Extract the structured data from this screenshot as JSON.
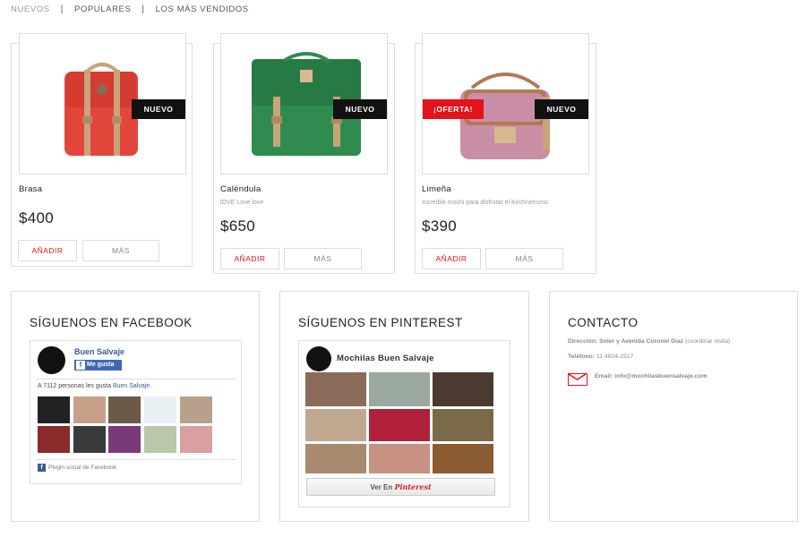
{
  "tabs": [
    {
      "label": "NUEVOS"
    },
    {
      "label": "POPULARES"
    },
    {
      "label": "LOS MÁS VENDIDOS"
    }
  ],
  "products": [
    {
      "name": "Brasa",
      "description": "",
      "price": "$400",
      "badges": [
        "NUEVO"
      ],
      "color": "#e2463b",
      "add_label": "AÑADIR",
      "more_label": "MÁS"
    },
    {
      "name": "Caléndula",
      "description": "lOVE Love love",
      "price": "$650",
      "badges": [
        "NUEVO"
      ],
      "color": "#2f8b4e",
      "add_label": "AÑADIR",
      "more_label": "MÁS"
    },
    {
      "name": "Limeña",
      "description": "Increíble mochi para disfrutar el Kirchnerismo.",
      "price": "$390",
      "badges": [
        "¡OFERTA!",
        "NUEVO"
      ],
      "color": "#c98ea5",
      "add_label": "AÑADIR",
      "more_label": "MÁS"
    }
  ],
  "facebook": {
    "heading": "SÍGUENOS EN FACEBOOK",
    "page_name": "Buen Salvaje",
    "like_label": "Me gusta",
    "count_text": "A 7112 personas les gusta",
    "count_link": "Buen Salvaje.",
    "plugin_label": "Plugin social de Facebook"
  },
  "pinterest": {
    "heading": "SÍGUENOS EN PINTEREST",
    "board_name": "Mochilas Buen Salvaje",
    "button_prefix": "Ver En",
    "button_brand": "Pinterest"
  },
  "contact": {
    "heading": "CONTACTO",
    "address_label": "Dirección:",
    "address_value": "Soler y Avenida Coronel Díaz",
    "address_note": "(coordinar visita)",
    "phone_label": "Teléfono:",
    "phone_value": "11 4824-2517",
    "email_label": "Email:",
    "email_value": "info@mochilasbuensalvaje.com"
  },
  "colors": {
    "accent": "#e3131b",
    "badge_new": "#111111",
    "facebook": "#3b5998",
    "pinterest": "#cb2027"
  }
}
